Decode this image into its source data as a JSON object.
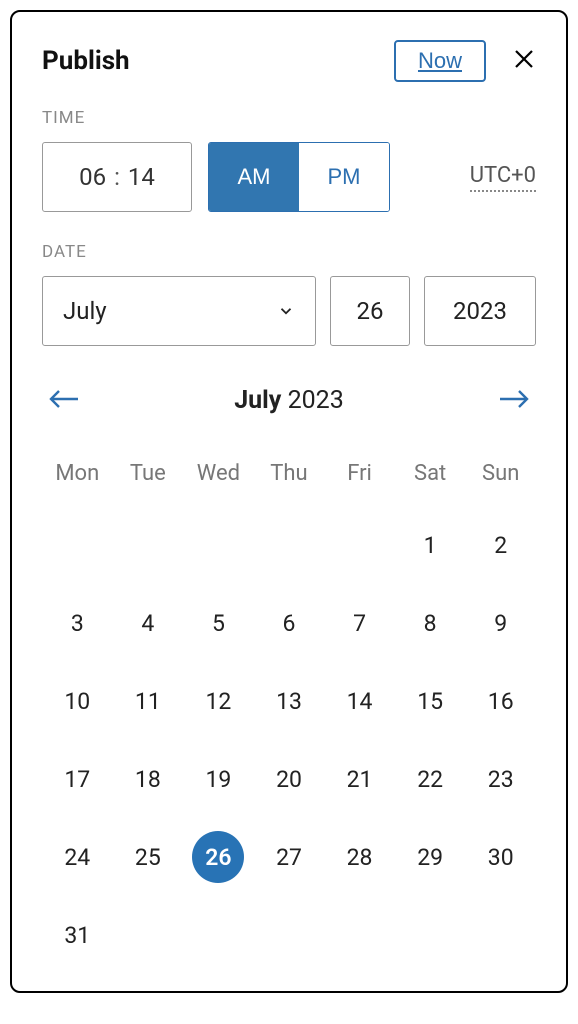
{
  "header": {
    "title": "Publish",
    "now_label": "Now"
  },
  "time": {
    "section_label": "TIME",
    "hours": "06",
    "minutes": "14",
    "am_label": "AM",
    "pm_label": "PM",
    "active": "AM",
    "timezone": "UTC+0"
  },
  "date": {
    "section_label": "DATE",
    "month": "July",
    "day": "26",
    "year": "2023"
  },
  "calendar": {
    "month": "July",
    "year": "2023",
    "dow": [
      "Mon",
      "Tue",
      "Wed",
      "Thu",
      "Fri",
      "Sat",
      "Sun"
    ],
    "leading_blanks": 5,
    "days_in_month": 31,
    "selected_day": 26
  }
}
